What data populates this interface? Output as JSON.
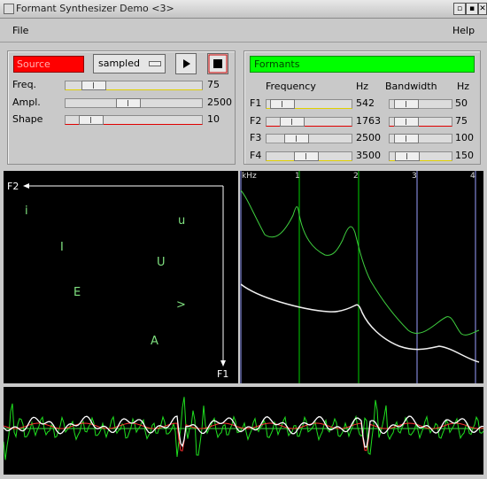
{
  "window": {
    "title": "Formant Synthesizer Demo <3>",
    "buttons": [
      "▫",
      "▪",
      "✕"
    ]
  },
  "menu": {
    "file": "File",
    "help": "Help"
  },
  "source": {
    "title": "Source",
    "mode": "sampled",
    "rows": [
      {
        "label": "Freq.",
        "value": "75",
        "level": 0.14
      },
      {
        "label": "Ampl.",
        "value": "2500",
        "level": 0.45
      },
      {
        "label": "Shape",
        "value": "10",
        "level": 0.12
      }
    ]
  },
  "formants": {
    "title": "Formants",
    "col_freq": "Frequency",
    "col_hz1": "Hz",
    "col_bw": "Bandwidth",
    "col_hz2": "Hz",
    "rows": [
      {
        "label": "F1",
        "freq": "542",
        "bw": "50",
        "freq_level": 0.06,
        "bw_level": 0.12
      },
      {
        "label": "F2",
        "freq": "1763",
        "bw": "75",
        "freq_level": 0.22,
        "bw_level": 0.12
      },
      {
        "label": "F3",
        "freq": "2500",
        "bw": "100",
        "freq_level": 0.3,
        "bw_level": 0.12
      },
      {
        "label": "F4",
        "freq": "3500",
        "bw": "150",
        "freq_level": 0.45,
        "bw_level": 0.14
      }
    ]
  },
  "vowel_chart": {
    "axis_y": "F2",
    "axis_x": "F1",
    "vowels": [
      "i",
      "u",
      "I",
      "U",
      "E",
      ">",
      "A"
    ]
  },
  "spectrum": {
    "unit": "kHz",
    "ticks": [
      "1",
      "2",
      "3",
      "4"
    ]
  }
}
